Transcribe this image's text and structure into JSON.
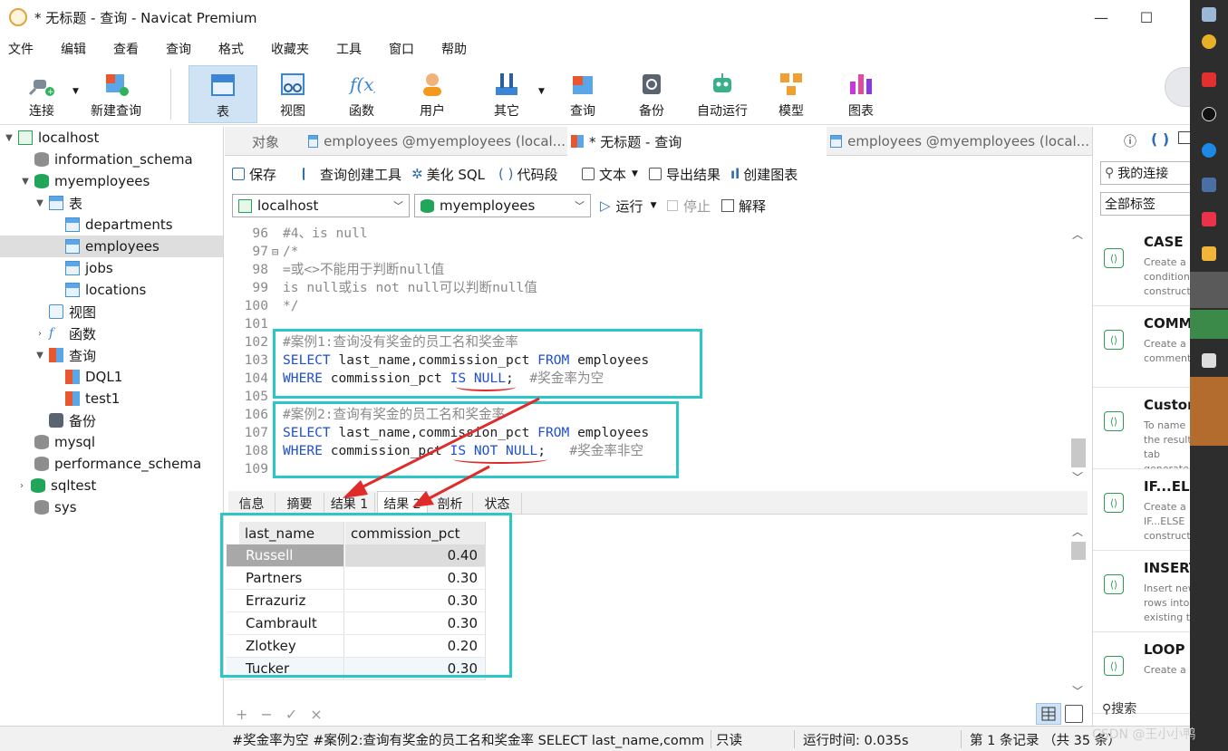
{
  "window": {
    "title": "* 无标题 - 查询 - Navicat Premium",
    "minimize_glyph": "—",
    "maximize_glyph": "☐"
  },
  "menu": [
    "文件",
    "编辑",
    "查看",
    "查询",
    "格式",
    "收藏夹",
    "工具",
    "窗口",
    "帮助"
  ],
  "toolbar": {
    "connect": "连接",
    "new_query": "新建查询",
    "table": "表",
    "view": "视图",
    "function": "函数",
    "user": "用户",
    "other": "其它",
    "query": "查询",
    "backup": "备份",
    "autorun": "自动运行",
    "model": "模型",
    "chart": "图表"
  },
  "tree": {
    "localhost": "localhost",
    "information_schema": "information_schema",
    "myemployees": "myemployees",
    "tables_group": "表",
    "tables": [
      "departments",
      "employees",
      "jobs",
      "locations"
    ],
    "views_group": "视图",
    "functions_group": "函数",
    "queries_group": "查询",
    "queries": [
      "DQL1",
      "test1"
    ],
    "backup_group": "备份",
    "other_dbs": [
      "mysql",
      "performance_schema",
      "sqltest",
      "sys"
    ]
  },
  "tabs": {
    "objects": "对象",
    "tab1": "employees @myemployees (local...",
    "tab2": "* 无标题 - 查询",
    "tab3": "employees @myemployees (local..."
  },
  "query_toolbar": {
    "save": "保存",
    "builder": "查询创建工具",
    "beautify": "美化 SQL",
    "snippet": "代码段",
    "text": "文本",
    "export": "导出结果",
    "create_chart": "创建图表"
  },
  "selectors": {
    "connection": "localhost",
    "database": "myemployees",
    "run": "运行",
    "stop": "停止",
    "explain": "解释"
  },
  "editor": {
    "lines": [
      {
        "n": "96",
        "text": "#4、is null"
      },
      {
        "n": "97",
        "text": "/*"
      },
      {
        "n": "98",
        "text": "=或<>不能用于判断null值"
      },
      {
        "n": "99",
        "text": "is null或is not null可以判断null值"
      },
      {
        "n": "100",
        "text": "*/"
      },
      {
        "n": "101",
        "text": ""
      },
      {
        "n": "102",
        "text": "#案例1:查询没有奖金的员工名和奖金率"
      },
      {
        "n": "103",
        "kw1": "SELECT",
        "mid": " last_name,commission_pct ",
        "kw2": "FROM",
        "tail": " employees"
      },
      {
        "n": "104",
        "kw1": "WHERE",
        "mid": " commission_pct ",
        "kw2": "IS NULL",
        "tail": ";",
        "cm": "  #奖金率为空"
      },
      {
        "n": "105",
        "text": ""
      },
      {
        "n": "106",
        "text": "#案例2:查询有奖金的员工名和奖金率"
      },
      {
        "n": "107",
        "kw1": "SELECT",
        "mid": " last_name,commission_pct ",
        "kw2": "FROM",
        "tail": " employees"
      },
      {
        "n": "108",
        "kw1": "WHERE",
        "mid": " commission_pct ",
        "kw2": "IS NOT NULL",
        "tail": ";",
        "cm": "   #奖金率非空"
      },
      {
        "n": "109",
        "text": ""
      }
    ]
  },
  "result_tabs": [
    "信息",
    "摘要",
    "结果 1",
    "结果 2",
    "剖析",
    "状态"
  ],
  "grid": {
    "columns": [
      "last_name",
      "commission_pct"
    ],
    "rows": [
      [
        "Russell",
        "0.40"
      ],
      [
        "Partners",
        "0.30"
      ],
      [
        "Errazuriz",
        "0.30"
      ],
      [
        "Cambrault",
        "0.30"
      ],
      [
        "Zlotkey",
        "0.20"
      ],
      [
        "Tucker",
        "0.30"
      ]
    ]
  },
  "bottom_tools": [
    "+",
    "−",
    "✓",
    "×"
  ],
  "status": {
    "sql": "#奖金率为空  #案例2:查询有奖金的员工名和奖金率 SELECT last_name,comm",
    "readonly": "只读",
    "time": "运行时间: 0.035s",
    "records": "第 1 条记录 （共 35 条）"
  },
  "right_panel": {
    "conn_filter": "我的连接",
    "tag_filter": "全部标签",
    "snippets": [
      {
        "title": "CASE",
        "desc": "Create a condition construct"
      },
      {
        "title": "COMM",
        "desc": "Create a comment"
      },
      {
        "title": "Custom",
        "desc": "To name the result tab generated executing statement"
      },
      {
        "title": "IF...ELS",
        "desc": "Create a IF...ELSE construct"
      },
      {
        "title": "INSERT",
        "desc": "Insert new rows into existing ta"
      },
      {
        "title": "LOOP",
        "desc": "Create a"
      }
    ],
    "search": "搜索"
  },
  "watermark": "CSDN @王小小鸭",
  "colors": {
    "accent": "#2cc5c8",
    "keyword": "#1f4fd0",
    "arrow": "#e02b2b",
    "selected_tab": "#cfe3f5"
  }
}
